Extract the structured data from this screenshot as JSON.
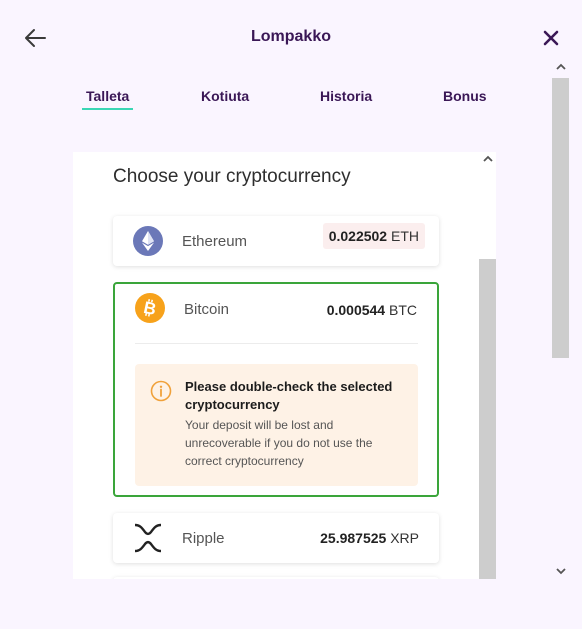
{
  "header": {
    "title": "Lompakko",
    "back_icon": "arrow-left-icon",
    "close_icon": "close-icon",
    "accent": "#3a1756"
  },
  "tabs": [
    {
      "label": "Talleta",
      "active": true
    },
    {
      "label": "Kotiuta",
      "active": false
    },
    {
      "label": "Historia",
      "active": false
    },
    {
      "label": "Bonus",
      "active": false
    }
  ],
  "tab_underline_color": "#3ad6b4",
  "panel": {
    "title": "Choose your cryptocurrency",
    "coins": [
      {
        "name": "Ethereum",
        "amount": "0.022502",
        "unit": "ETH",
        "icon": "ethereum-icon",
        "color": "#6b78b8"
      },
      {
        "name": "Bitcoin",
        "amount": "0.000544",
        "unit": "BTC",
        "icon": "bitcoin-icon",
        "color": "#f7a21b",
        "selected": true
      },
      {
        "name": "Ripple",
        "amount": "25.987525",
        "unit": "XRP",
        "icon": "ripple-icon",
        "color": "#222222"
      }
    ],
    "warning": {
      "icon": "info-icon",
      "title": "Please double-check the selected cryptocurrency",
      "text": "Your deposit will be lost and unrecoverable if you do not use the correct cryptocurrency"
    }
  }
}
